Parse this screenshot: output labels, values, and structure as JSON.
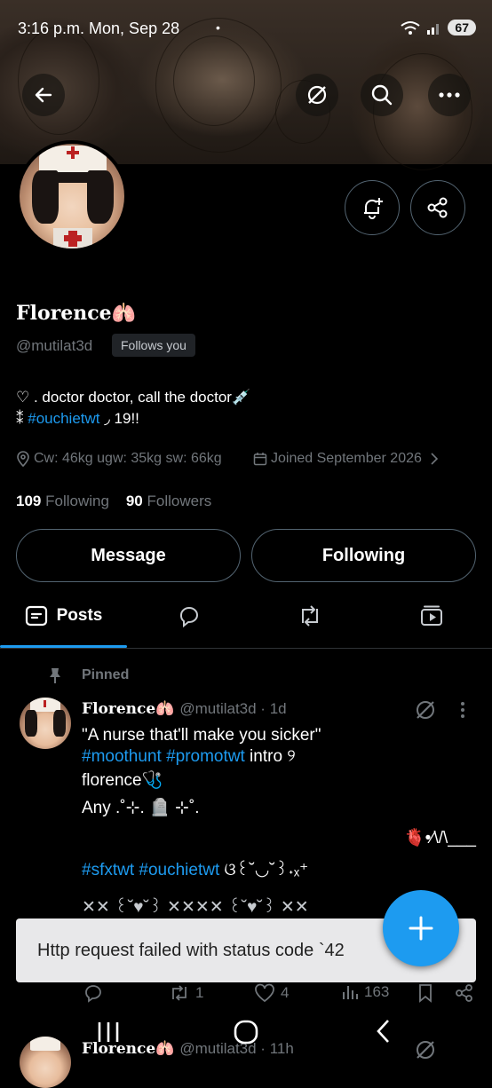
{
  "status_bar": {
    "time": "3:16 p.m.  Mon, Sep 28",
    "dot": "•",
    "battery": "67"
  },
  "profile": {
    "display_name": "Florence🫁",
    "handle": "@mutilat3d",
    "follows_you": "Follows you",
    "bio_line1": "♡ . doctor doctor, call the doctor💉",
    "bio_line2_prefix": "⁑ ",
    "bio_hashtag": "#ouchietwt",
    "bio_line2_suffix": " ◞ 19!!",
    "location": "Cw: 46kg ugw: 35kg sw: 66kg",
    "joined": "Joined September 2026",
    "following_count": "109",
    "following_label": "Following",
    "followers_count": "90",
    "followers_label": "Followers"
  },
  "buttons": {
    "message": "Message",
    "following": "Following"
  },
  "tabs": {
    "posts": "Posts"
  },
  "pinned_tweet": {
    "pinned_label": "Pinned",
    "name": "Florence🫁",
    "handle_time": "@mutilat3d · 1d",
    "line1": "\"A nurse that'll make you sicker\"",
    "line2_tags": "#moothunt #promotwt",
    "line2_rest": " intro ୨",
    "line3": "florence🩺",
    "line4": "Any .˚⊹. 🪦 ⊹˚.",
    "line5": "🫀•⁄\\/\\___",
    "line6_tags": "#sfxtwt #ouchietwt",
    "line6_rest": " ଓ꒰˘◡˘꒱˖ₓ⁺",
    "line7": "✕✕ ꒰˘♥˘꒱ ✕✕✕✕ ꒰˘♥˘꒱ ✕✕",
    "retweets": "1",
    "likes": "4",
    "views": "163"
  },
  "snackbar": {
    "text": "Http request failed with status code `42"
  },
  "next_tweet": {
    "name": "Florence🫁",
    "handle_time": "@mutilat3d · 11h"
  },
  "colors": {
    "accent": "#1d9bf0",
    "background": "#000000",
    "muted": "#71767b",
    "border": "#536471"
  },
  "icons": [
    "back-arrow-icon",
    "grok-icon",
    "search-icon",
    "more-icon",
    "bell-plus-icon",
    "share-icon",
    "location-icon",
    "calendar-icon",
    "chevron-right-icon",
    "posts-icon",
    "replies-icon",
    "reposts-icon",
    "media-icon",
    "pin-icon",
    "reply-icon",
    "retweet-icon",
    "like-icon",
    "views-icon",
    "bookmark-icon",
    "plus-icon",
    "recent-apps-icon",
    "home-icon",
    "nav-back-icon"
  ]
}
